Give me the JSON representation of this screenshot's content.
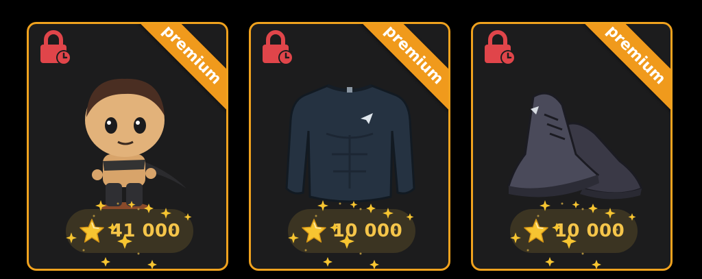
{
  "cards": [
    {
      "badge": "premium",
      "price": "41 000",
      "item": "character"
    },
    {
      "badge": "premium",
      "price": "10 000",
      "item": "shirt"
    },
    {
      "badge": "premium",
      "price": "10 000",
      "item": "sneakers"
    }
  ],
  "icons": {
    "lock": "lock-clock-icon",
    "currency": "star-icon"
  },
  "colors": {
    "accent": "#f0a21e",
    "price_text": "#f5c54a",
    "lock": "#e0454a",
    "card_bg": "#1c1c1d"
  }
}
